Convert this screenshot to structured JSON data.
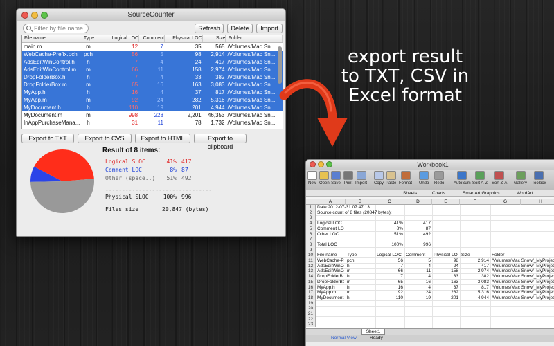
{
  "sourcecounter": {
    "title": "SourceCounter",
    "search_placeholder": "Filter by file name",
    "buttons": {
      "refresh": "Refresh",
      "delete": "Delete",
      "import": "Import"
    },
    "columns": [
      "File name",
      "Type",
      "Logical LOC",
      "Comment",
      "Physical LOC",
      "Size",
      "Folder"
    ],
    "rows": [
      {
        "name": "main.m",
        "type": "m",
        "logical": "12",
        "comment": "7",
        "physical": "35",
        "size": "565",
        "folder": "/Volumes/Mac Sn...",
        "selected": false
      },
      {
        "name": "WebCache-Prefix.pch",
        "type": "pch",
        "logical": "56",
        "comment": "5",
        "physical": "98",
        "size": "2,914",
        "folder": "/Volumes/Mac Sn...",
        "selected": true
      },
      {
        "name": "AdsEditWinControl.h",
        "type": "h",
        "logical": "7",
        "comment": "4",
        "physical": "24",
        "size": "417",
        "folder": "/Volumes/Mac Sn...",
        "selected": true
      },
      {
        "name": "AdsEditWinControl.m",
        "type": "m",
        "logical": "66",
        "comment": "11",
        "physical": "158",
        "size": "2,974",
        "folder": "/Volumes/Mac Sn...",
        "selected": true
      },
      {
        "name": "DropFolderBox.h",
        "type": "h",
        "logical": "7",
        "comment": "4",
        "physical": "33",
        "size": "382",
        "folder": "/Volumes/Mac Sn...",
        "selected": true
      },
      {
        "name": "DropFolderBox.m",
        "type": "m",
        "logical": "65",
        "comment": "16",
        "physical": "163",
        "size": "3,083",
        "folder": "/Volumes/Mac Sn...",
        "selected": true
      },
      {
        "name": "MyApp.h",
        "type": "h",
        "logical": "16",
        "comment": "4",
        "physical": "37",
        "size": "817",
        "folder": "/Volumes/Mac Sn...",
        "selected": true
      },
      {
        "name": "MyApp.m",
        "type": "m",
        "logical": "92",
        "comment": "24",
        "physical": "282",
        "size": "5,316",
        "folder": "/Volumes/Mac Sn...",
        "selected": true
      },
      {
        "name": "MyDocument.h",
        "type": "h",
        "logical": "110",
        "comment": "19",
        "physical": "201",
        "size": "4,944",
        "folder": "/Volumes/Mac Sn...",
        "selected": true
      },
      {
        "name": "MyDocument.m",
        "type": "m",
        "logical": "998",
        "comment": "228",
        "physical": "2,201",
        "size": "46,353",
        "folder": "/Volumes/Mac Sn...",
        "selected": false
      },
      {
        "name": "InAppPurchaseMana...",
        "type": "h",
        "logical": "31",
        "comment": "11",
        "physical": "78",
        "size": "1,732",
        "folder": "/Volumes/Mac Sn...",
        "selected": false
      }
    ],
    "export_buttons": [
      "Export to TXT",
      "Export to CVS",
      "Export to HTML",
      "Export to clipboard"
    ],
    "result_title": "Result of 8 items:",
    "stats": [
      {
        "label": "Logical SLOC",
        "pct": "41%",
        "value": "417",
        "color": "#e02020"
      },
      {
        "label": "Comment LOC",
        "pct": "8%",
        "value": "87",
        "color": "#1a3fd8"
      },
      {
        "label": "Other (space..)",
        "pct": "51%",
        "value": "492",
        "color": "#666666"
      }
    ],
    "separator": "--------------------------------",
    "physical": {
      "label": "Physical SLOC",
      "pct": "100%",
      "value": "996"
    },
    "filesize": {
      "label": "Files size",
      "value": "20,847 (bytes)"
    }
  },
  "chart_data": {
    "type": "pie",
    "categories": [
      "Logical SLOC",
      "Comment LOC",
      "Other (space..)"
    ],
    "values": [
      41,
      8,
      51
    ],
    "colors": [
      "#ff2d1a",
      "#2a44e8",
      "#999999"
    ]
  },
  "caption": {
    "line1": "export result",
    "line2": "to TXT, CSV in",
    "line3": "Excel format"
  },
  "excel": {
    "title": "Workbook1",
    "toolbar": [
      "New",
      "Open",
      "Save",
      "Print",
      "Import",
      "Copy",
      "Paste",
      "Format",
      "Undo",
      "Redo",
      "AutoSum",
      "Sort A-Z",
      "Sort Z-A",
      "Gallery",
      "Toolbox"
    ],
    "ribbon": [
      "Sheets",
      "Charts",
      "SmartArt Graphics",
      "WordArt"
    ],
    "col_headers": [
      "A",
      "B",
      "C",
      "D",
      "E",
      "F",
      "G",
      "H"
    ],
    "rows": [
      {
        "n": "1",
        "cells": [
          "Date:2012-07-31 07:47:13",
          "",
          "",
          "",
          "",
          "",
          "",
          ""
        ]
      },
      {
        "n": "2",
        "cells": [
          "Source count of 8 files (20847 bytes):",
          "",
          "",
          "",
          "",
          "",
          "",
          ""
        ]
      },
      {
        "n": "3",
        "cells": [
          "",
          "",
          "",
          "",
          "",
          "",
          "",
          ""
        ]
      },
      {
        "n": "4",
        "cells": [
          "Logical LOC",
          "",
          "41%",
          "417",
          "",
          "",
          "",
          ""
        ]
      },
      {
        "n": "5",
        "cells": [
          "Comment LOC",
          "",
          "8%",
          "87",
          "",
          "",
          "",
          ""
        ]
      },
      {
        "n": "6",
        "cells": [
          "Other LOC",
          "",
          "51%",
          "492",
          "",
          "",
          "",
          ""
        ]
      },
      {
        "n": "7",
        "cells": [
          "-----------------------------",
          "",
          "",
          "",
          "",
          "",
          "",
          ""
        ]
      },
      {
        "n": "8",
        "cells": [
          "Total LOC",
          "",
          "100%",
          "996",
          "",
          "",
          "",
          ""
        ]
      },
      {
        "n": "9",
        "cells": [
          "",
          "",
          "",
          "",
          "",
          "",
          "",
          ""
        ]
      },
      {
        "n": "10",
        "cells": [
          "File name",
          "Type",
          "Logical LOC",
          "Comment",
          "Physical LOC",
          "Size",
          "Folder",
          ""
        ]
      },
      {
        "n": "11",
        "cells": [
          "WebCache-Pre",
          "pch",
          "56",
          "5",
          "98",
          "2,914",
          "/Volumes/Mac Snow/_MyProject",
          ""
        ]
      },
      {
        "n": "12",
        "cells": [
          "AdsEditWinCo",
          "h",
          "7",
          "4",
          "24",
          "417",
          "/Volumes/Mac Snow/_MyProject",
          ""
        ]
      },
      {
        "n": "13",
        "cells": [
          "AdsEditWinCo",
          "m",
          "66",
          "11",
          "158",
          "2,974",
          "/Volumes/Mac Snow/_MyProject",
          ""
        ]
      },
      {
        "n": "14",
        "cells": [
          "DropFolderBo",
          "h",
          "7",
          "4",
          "33",
          "382",
          "/Volumes/Mac Snow/_MyProject",
          ""
        ]
      },
      {
        "n": "15",
        "cells": [
          "DropFolderBo",
          "m",
          "65",
          "16",
          "163",
          "3,083",
          "/Volumes/Mac Snow/_MyProject",
          ""
        ]
      },
      {
        "n": "16",
        "cells": [
          "MyApp.h",
          "h",
          "16",
          "4",
          "37",
          "817",
          "/Volumes/Mac Snow/_MyProject",
          ""
        ]
      },
      {
        "n": "17",
        "cells": [
          "MyApp.m",
          "m",
          "92",
          "24",
          "282",
          "5,316",
          "/Volumes/Mac Snow/_MyProject",
          ""
        ]
      },
      {
        "n": "18",
        "cells": [
          "MyDocument.h",
          "h",
          "110",
          "19",
          "201",
          "4,944",
          "/Volumes/Mac Snow/_MyProject",
          ""
        ]
      },
      {
        "n": "19",
        "cells": [
          "",
          "",
          "",
          "",
          "",
          "",
          "",
          ""
        ]
      },
      {
        "n": "20",
        "cells": [
          "",
          "",
          "",
          "",
          "",
          "",
          "",
          ""
        ]
      },
      {
        "n": "21",
        "cells": [
          "",
          "",
          "",
          "",
          "",
          "",
          "",
          ""
        ]
      },
      {
        "n": "22",
        "cells": [
          "",
          "",
          "",
          "",
          "",
          "",
          "",
          ""
        ]
      },
      {
        "n": "23",
        "cells": [
          "",
          "",
          "",
          "",
          "",
          "",
          "",
          ""
        ]
      }
    ],
    "sheet_tab": "Sheet1",
    "status": {
      "view": "Normal View",
      "ready": "Ready"
    }
  }
}
